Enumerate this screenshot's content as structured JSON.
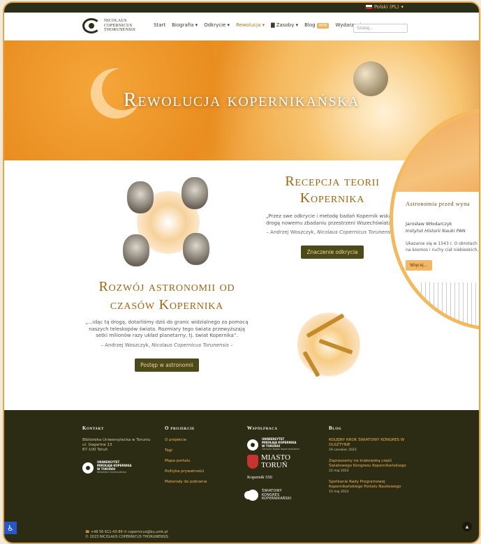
{
  "topbar": {
    "language": "Polski (PL)"
  },
  "logo": {
    "line1": "NICOLAUS",
    "line2": "COPERNICUS",
    "line3": "THORUNENSIS"
  },
  "nav": {
    "items": [
      "Start",
      "Biografia ▾",
      "Odkrycie ▾",
      "Rewolucja ▾",
      "Zasoby ▾",
      "Blog",
      "Wydarzenia ▾"
    ],
    "blog_badge": "NEW",
    "search_placeholder": "Szukaj..."
  },
  "hero": {
    "title": "Rewolucja kopernikańska"
  },
  "section1": {
    "title": "Recepcja teorii Kopernika",
    "quote": "„Przez swe odkrycie i metodę badań Kopernik wskazał drogę nowemu zbadaniu przestrzeni Wszechświata...”",
    "author": "– Andrzej Woszczyk,",
    "author_work": "Nicolaus Copernicus Torunensis –",
    "button": "Znaczenie odkrycia"
  },
  "section2": {
    "title": "Rozwój astronomii od czasów Kopernika",
    "quote": "„...idąc tą drogą, dotarliśmy dziś do granic widzialnego za pomocą naszych teleskopów świata. Rozmiary tego świata przewyższają setki milionów razy układ planetarny, tj. świat Kopernika”.",
    "author": "– Andrzej Woszczyk,",
    "author_work": "Nicolaus Copernicus Torunensis –",
    "button": "Postęp w astronomii"
  },
  "magnifier": {
    "title": "Astronomia przed wyna",
    "author": "Jarosław Włodarczyk",
    "institution": "Instytut Historii Nauki PAN",
    "desc_line1": "Ukazanie się w 1543 r. O obrotach K",
    "desc_line2": "na kosmos i ruchy ciał niebieskich, a",
    "button": "Więcej..."
  },
  "footer": {
    "contact": {
      "heading": "Kontakt",
      "lines": [
        "Biblioteka Uniwersytecka w Toruniu",
        "ul. Gagarina 13",
        "87-100 Toruń"
      ],
      "logo_text": [
        "UNIWERSYTET",
        "MIKOŁAJA KOPERNIKA",
        "W TORUNIU"
      ],
      "logo_sub": "Biblioteka Uniwersytecka"
    },
    "project": {
      "heading": "O projekcie",
      "links": [
        "O projekcie",
        "Tagi",
        "Mapa portalu",
        "Polityka prywatności",
        "Materiały do pobrania"
      ]
    },
    "cooperation": {
      "heading": "Współpraca",
      "umk_text": [
        "UNIWERSYTET",
        "MIKOŁAJA KOPERNIKA",
        "W TORUNIU"
      ],
      "umk_sub": "Centrum Badań Kopernikańskich",
      "miasto": [
        "MIASTO",
        "TORUŃ"
      ],
      "kopernik550": "Kopernik 550",
      "swiatowy": [
        "ŚWIATOWY",
        "KONGRES",
        "KOPERNIKAŃSKI"
      ]
    },
    "blog": {
      "heading": "Blog",
      "items": [
        {
          "title": "KOLEJNY KROK ŚWIATOWY KONGRES W OLSZTYNIE",
          "date": "19 czerwiec 2023"
        },
        {
          "title": "Zapraszamy na krakowską część Światowego Kongresu Kopernikańskiego",
          "date": "22 maj 2023"
        },
        {
          "title": "Spotkanie Rady Programowej Kopernikańskiego Portalu Naukowego",
          "date": "15 maj 2023"
        }
      ]
    },
    "bottom": {
      "phone": "+48 56 611-43-86",
      "email": "copernicus@bu.umk.pl",
      "copyright": "© 2023 NICOLAUS COPERNICUS THORUNENSIS"
    }
  },
  "colors": {
    "accent": "#a4640f",
    "footer_bg": "#2b2c13",
    "button_bg": "#4c4a1a",
    "link": "#f0b45b"
  }
}
